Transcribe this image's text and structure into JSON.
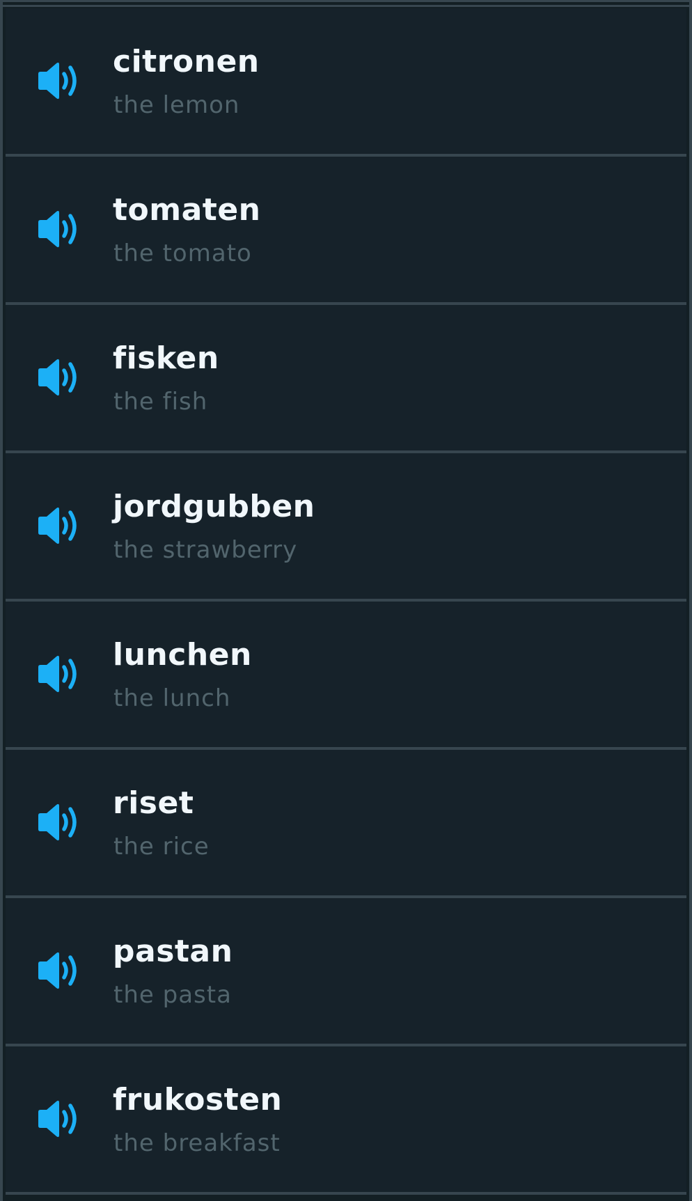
{
  "accent_color": "#1cb0f6",
  "speaker_icon": "speaker-volume-icon",
  "items": [
    {
      "word": "citronen",
      "translation": "the lemon"
    },
    {
      "word": "tomaten",
      "translation": "the tomato"
    },
    {
      "word": "fisken",
      "translation": "the fish"
    },
    {
      "word": "jordgubben",
      "translation": "the strawberry"
    },
    {
      "word": "lunchen",
      "translation": "the lunch"
    },
    {
      "word": "riset",
      "translation": "the rice"
    },
    {
      "word": "pastan",
      "translation": "the pasta"
    },
    {
      "word": "frukosten",
      "translation": "the breakfast"
    }
  ]
}
